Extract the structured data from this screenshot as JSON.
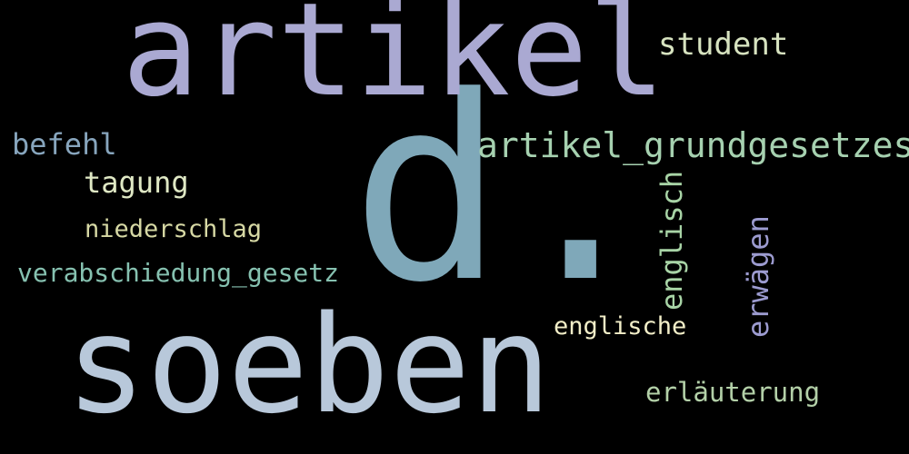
{
  "words": {
    "d": {
      "text": "d.",
      "color": "#7fa8b9"
    },
    "artikel": {
      "text": "artikel",
      "color": "#aaa9d2"
    },
    "soeben": {
      "text": "soeben",
      "color": "#b8c8da"
    },
    "student": {
      "text": "student",
      "color": "#d7e3c0"
    },
    "artikel_grundgesetzes": {
      "text": "artikel_grundgesetzes",
      "color": "#a6d1b0"
    },
    "befehl": {
      "text": "befehl",
      "color": "#87a5bd"
    },
    "tagung": {
      "text": "tagung",
      "color": "#dfe8c4"
    },
    "niederschlag": {
      "text": "niederschlag",
      "color": "#d6d8a4"
    },
    "verabschiedung_gesetz": {
      "text": "verabschiedung_gesetz",
      "color": "#86c1b0"
    },
    "englisch": {
      "text": "englisch",
      "color": "#a8d4a6"
    },
    "erwaegen": {
      "text": "erwägen",
      "color": "#9c9bd0"
    },
    "englische": {
      "text": "englische",
      "color": "#f2eec8"
    },
    "erlaeuterung": {
      "text": "erläuterung",
      "color": "#b3d0a8"
    }
  }
}
